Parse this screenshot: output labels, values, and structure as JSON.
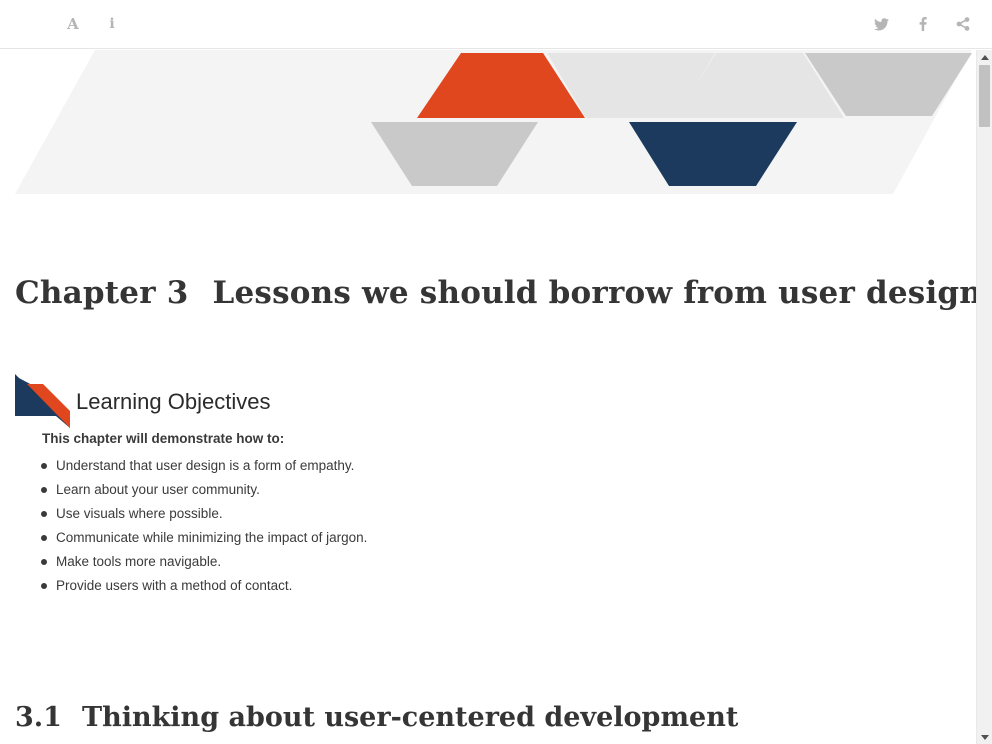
{
  "toolbar": {
    "left_icons": [
      {
        "name": "font-size-icon",
        "glyph": "A"
      },
      {
        "name": "info-icon",
        "glyph": "i"
      }
    ],
    "right_icons": [
      {
        "name": "twitter-icon"
      },
      {
        "name": "facebook-icon"
      },
      {
        "name": "share-icon"
      }
    ]
  },
  "colors": {
    "accent_orange": "#e0471f",
    "accent_navy": "#1b3a5e",
    "gray_tile": "#c9c9c9",
    "light_tile": "#e5e5e5",
    "banner_bg": "#f4f4f4",
    "heading_text": "#353535",
    "toolbar_icon": "#b5b5b5"
  },
  "chapter": {
    "number": "Chapter 3",
    "title": "Lessons we should borrow from user designers"
  },
  "learning_objectives": {
    "heading": "Learning Objectives",
    "intro": "This chapter will demonstrate how to:",
    "items": [
      "Understand that user design is a form of empathy.",
      "Learn about your user community.",
      "Use visuals where possible.",
      "Communicate while minimizing the impact of jargon.",
      "Make tools more navigable.",
      "Provide users with a method of contact."
    ]
  },
  "section": {
    "number": "3.1",
    "title": "Thinking about user-centered development"
  }
}
